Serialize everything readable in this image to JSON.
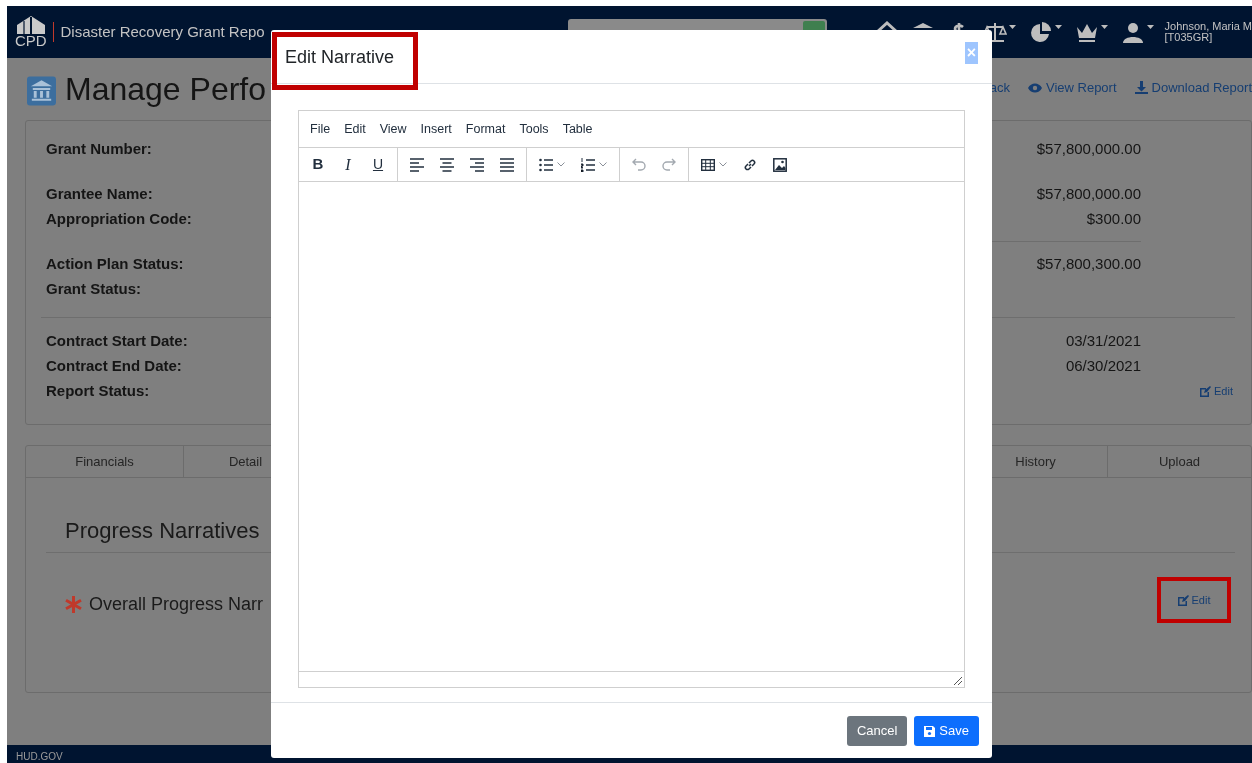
{
  "header": {
    "logo_text": "CPD",
    "title": "Disaster Recovery Grant Repo",
    "user_name": "Johnson, Maria M",
    "user_id": "[T035GR]"
  },
  "page": {
    "title": "Manage Perfo",
    "links": [
      {
        "label": "ack",
        "kind": "back"
      },
      {
        "label": "View Report",
        "kind": "view"
      },
      {
        "label": "Download Report",
        "kind": "download"
      }
    ]
  },
  "summary": {
    "sections": [
      {
        "divider_above": false,
        "rows": [
          {
            "label": "Grant Number:",
            "value": "$57,800,000.00",
            "rule_above": false
          }
        ]
      },
      {
        "divider_above": false,
        "rows": [
          {
            "label": "Grantee Name:",
            "value": "$57,800,000.00",
            "rule_above": false
          },
          {
            "label": "Appropriation Code:",
            "value": "$300.00",
            "rule_above": false
          }
        ]
      },
      {
        "divider_above": false,
        "rows": [
          {
            "label": "Action Plan Status:",
            "value": "$57,800,300.00",
            "rule_above": true
          },
          {
            "label": "Grant Status:",
            "rule_above": false
          }
        ]
      },
      {
        "divider_above": true,
        "rows": [
          {
            "label": "Contract Start Date:",
            "value": "03/31/2021",
            "rule_above": false
          },
          {
            "label": "Contract End Date:",
            "value": "06/30/2021",
            "rule_above": false
          },
          {
            "label": "Report Status:",
            "edit_label": "Edit",
            "rule_above": false
          }
        ]
      }
    ]
  },
  "tabs_left": [
    {
      "label": "Financials"
    },
    {
      "label": "Detail"
    }
  ],
  "tabs_right": [
    {
      "label": "History"
    },
    {
      "label": "Upload"
    }
  ],
  "narratives": {
    "heading": "Progress Narratives",
    "items": [
      {
        "label": "Overall Progress Narr",
        "required": true,
        "edit_label": "Edit",
        "highlighted": true
      }
    ]
  },
  "footer": {
    "text": "HUD.GOV"
  },
  "modal": {
    "title": "Edit Narrative",
    "title_highlighted": true,
    "close": "×",
    "menu": [
      "File",
      "Edit",
      "View",
      "Insert",
      "Format",
      "Tools",
      "Table"
    ],
    "toolbar": [
      [
        {
          "kind": "bold",
          "glyph": "B",
          "disabled": false
        },
        {
          "kind": "italic",
          "glyph": "I",
          "disabled": false
        },
        {
          "kind": "underline",
          "glyph": "U",
          "disabled": false
        }
      ],
      [
        {
          "kind": "align-left",
          "disabled": false
        },
        {
          "kind": "align-center",
          "disabled": false
        },
        {
          "kind": "align-right",
          "disabled": false
        },
        {
          "kind": "justify",
          "disabled": false
        }
      ],
      [
        {
          "kind": "bullet-list",
          "disabled": false
        },
        {
          "kind": "numbered-list",
          "disabled": false
        }
      ],
      [
        {
          "kind": "undo",
          "disabled": true
        },
        {
          "kind": "redo",
          "disabled": true
        }
      ],
      [
        {
          "kind": "table",
          "disabled": false
        },
        {
          "kind": "link",
          "disabled": false
        },
        {
          "kind": "image",
          "disabled": false
        }
      ]
    ],
    "buttons": [
      {
        "label": "Cancel",
        "kind": "secondary"
      },
      {
        "label": "Save",
        "kind": "primary"
      }
    ]
  }
}
